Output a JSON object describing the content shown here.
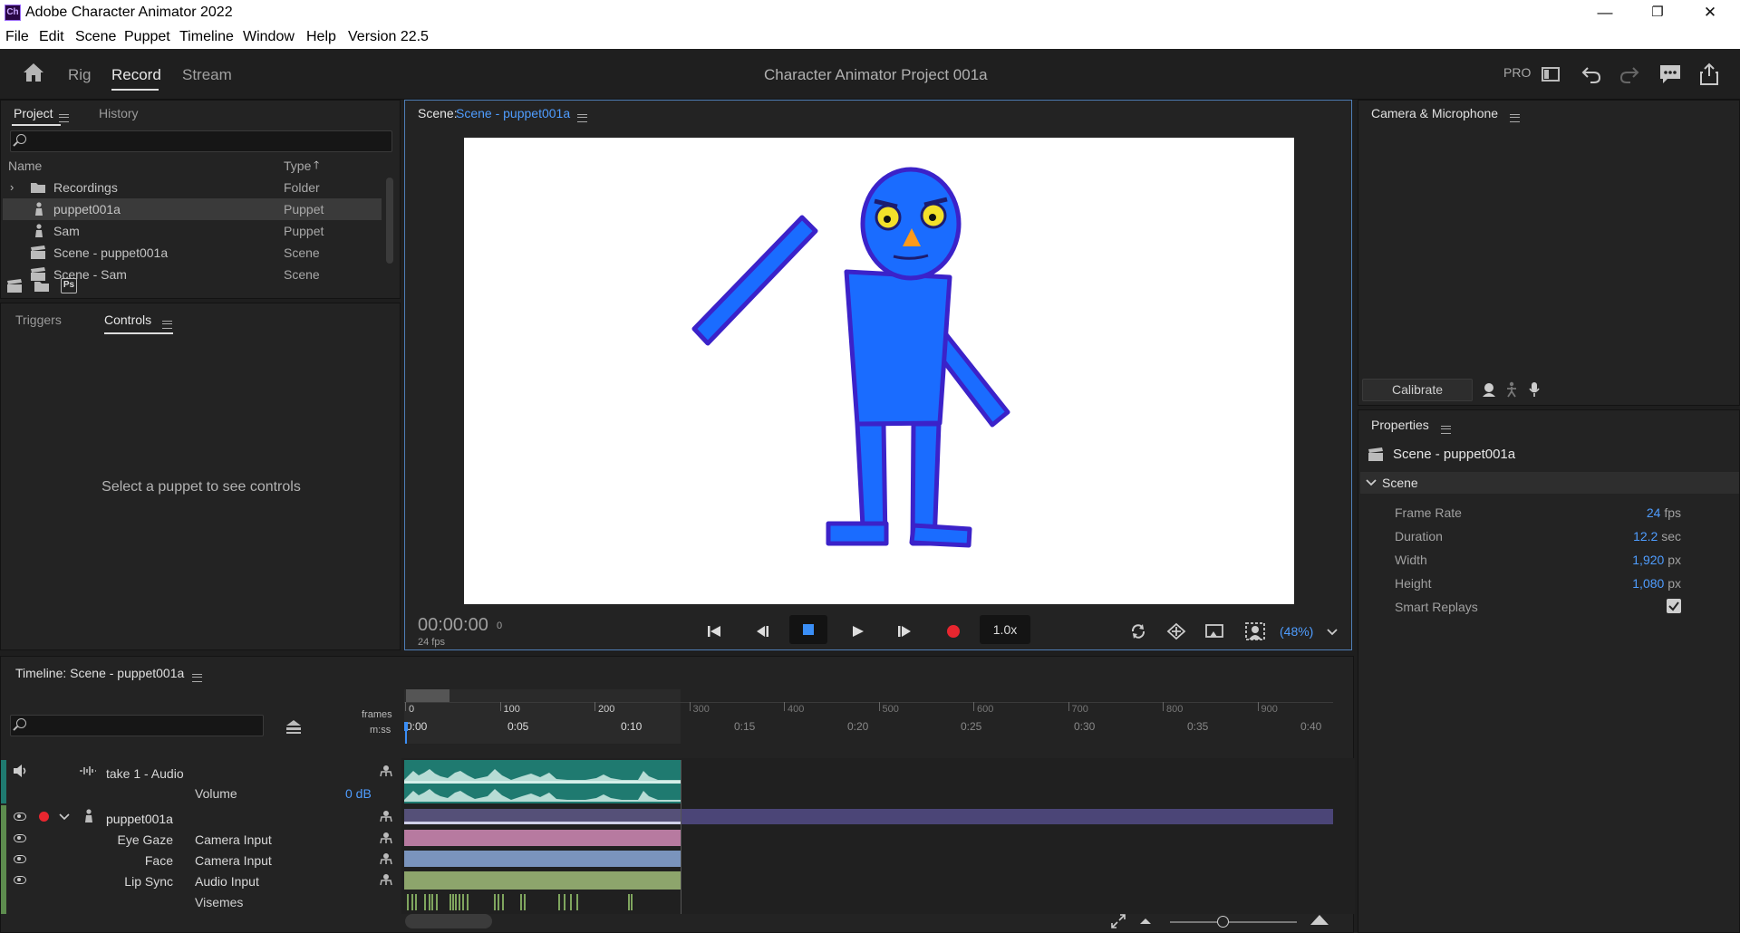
{
  "window": {
    "app_title": "Adobe Character Animator 2022",
    "app_icon": "Ch",
    "minimize": "—",
    "restore": "❐",
    "close": "✕"
  },
  "menu": [
    "File",
    "Edit",
    "Scene",
    "Puppet",
    "Timeline",
    "Window",
    "Help",
    "Version 22.5"
  ],
  "topbar": {
    "tabs": [
      "Rig",
      "Record",
      "Stream"
    ],
    "active_tab": "Record",
    "project_title": "Character Animator Project 001a",
    "pro_label": "PRO"
  },
  "project_panel": {
    "tabs": [
      "Project",
      "History"
    ],
    "columns": {
      "name": "Name",
      "type": "Type"
    },
    "rows": [
      {
        "name": "Recordings",
        "type": "Folder",
        "icon": "folder-icon"
      },
      {
        "name": "puppet001a",
        "type": "Puppet",
        "icon": "puppet-icon",
        "selected": true
      },
      {
        "name": "Sam",
        "type": "Puppet",
        "icon": "puppet-icon"
      },
      {
        "name": "Scene - puppet001a",
        "type": "Scene",
        "icon": "scene-icon"
      },
      {
        "name": "Scene - Sam",
        "type": "Scene",
        "icon": "scene-icon"
      }
    ],
    "ps_label": "Ps"
  },
  "controls_panel": {
    "tabs": [
      "Triggers",
      "Controls"
    ],
    "empty_message": "Select a puppet to see controls"
  },
  "scene_panel": {
    "label": "Scene:",
    "scene_name": "Scene - puppet001a",
    "timecode": "00:00:00",
    "frame": "0",
    "fps": "24 fps",
    "speed": "1.0x",
    "zoom": "(48%)"
  },
  "camera_panel": {
    "title": "Camera & Microphone",
    "calibrate": "Calibrate"
  },
  "properties_panel": {
    "title": "Properties",
    "scene_name": "Scene - puppet001a",
    "section": "Scene",
    "items": [
      {
        "label": "Frame Rate",
        "value": "24",
        "unit": "fps"
      },
      {
        "label": "Duration",
        "value": "12.2",
        "unit": "sec"
      },
      {
        "label": "Width",
        "value": "1,920",
        "unit": "px"
      },
      {
        "label": "Height",
        "value": "1,080",
        "unit": "px"
      },
      {
        "label": "Smart Replays",
        "value": "",
        "unit": ""
      }
    ],
    "smart_replays_checked": true
  },
  "timeline": {
    "title": "Timeline: Scene - puppet001a",
    "frames_label": "frames",
    "mss_label": "m:ss",
    "frame_ticks": [
      "0",
      "100",
      "200",
      "300",
      "400",
      "500",
      "600",
      "700",
      "800",
      "900"
    ],
    "time_ticks": [
      "0:00",
      "0:05",
      "0:10",
      "0:15",
      "0:20",
      "0:25",
      "0:30",
      "0:35",
      "0:40"
    ],
    "tracks": {
      "audio": "take 1 - Audio",
      "volume_label": "Volume",
      "volume_value": "0 dB",
      "puppet": "puppet001a",
      "behaviors": [
        {
          "name": "Eye Gaze",
          "input": "Camera Input"
        },
        {
          "name": "Face",
          "input": "Camera Input"
        },
        {
          "name": "Lip Sync",
          "input": "Audio Input"
        }
      ],
      "visemes": "Visemes"
    }
  },
  "colors": {
    "accent": "#4f9dff",
    "audio_track": "#1f7a70",
    "puppet_track": "#4b4577",
    "eye_gaze_track": "#b77aa0",
    "face_track": "#7a94bd",
    "lip_sync_track": "#8da56c",
    "puppet_fill": "#1a6cff",
    "puppet_outline": "#3b22c9"
  }
}
